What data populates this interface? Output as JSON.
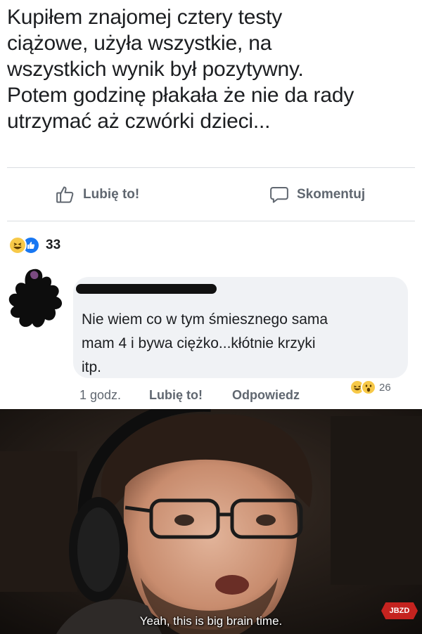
{
  "post": {
    "text_lines": [
      "Kupiłem znajomej cztery testy",
      "ciążowe, użyła wszystkie, na",
      "wszystkich wynik był pozytywny.",
      "Potem godzinę płakała że nie da rady",
      "utrzymać aż czwórki dzieci..."
    ],
    "actions": {
      "like_label": "Lubię to!",
      "comment_label": "Skomentuj"
    },
    "reactions": {
      "icons": [
        "haha-reaction",
        "like-reaction"
      ],
      "count": "33"
    }
  },
  "comment": {
    "text_lines": [
      "Nie wiem co w tym śmiesznego sama",
      "mam 4 i bywa ciężko...kłótnie krzyki",
      "itp."
    ],
    "meta": {
      "time": "1 godz.",
      "like_label": "Lubię to!",
      "reply_label": "Odpowiedz",
      "reactions": {
        "icons": [
          "haha-reaction",
          "wow-reaction"
        ],
        "count": "26"
      }
    }
  },
  "meme": {
    "subtitle": "Yeah, this is big brain time.",
    "watermark": "JBZD"
  },
  "colors": {
    "text_primary": "#1c1e21",
    "text_secondary": "#606770",
    "like_blue": "#1877f2",
    "haha_yellow": "#f7c948",
    "bubble_bg": "#f0f2f5",
    "watermark_red": "#c5231f"
  }
}
